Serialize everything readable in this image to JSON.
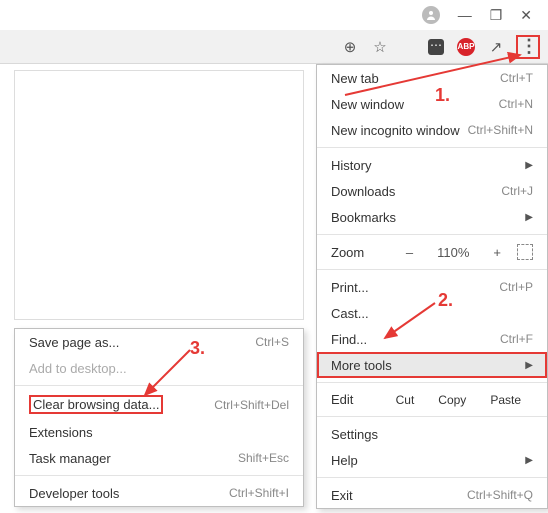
{
  "window": {
    "minimize": "—",
    "maximize": "❐",
    "close": "✕"
  },
  "toolbar": {
    "zoom_icon": "⊕",
    "star_icon": "☆",
    "share_icon": "↗"
  },
  "menu": {
    "new_tab": {
      "label": "New tab",
      "shortcut": "Ctrl+T"
    },
    "new_window": {
      "label": "New window",
      "shortcut": "Ctrl+N"
    },
    "new_incognito": {
      "label": "New incognito window",
      "shortcut": "Ctrl+Shift+N"
    },
    "history": {
      "label": "History"
    },
    "downloads": {
      "label": "Downloads",
      "shortcut": "Ctrl+J"
    },
    "bookmarks": {
      "label": "Bookmarks"
    },
    "zoom": {
      "label": "Zoom",
      "minus": "–",
      "value": "110%",
      "plus": "+"
    },
    "print": {
      "label": "Print...",
      "shortcut": "Ctrl+P"
    },
    "cast": {
      "label": "Cast..."
    },
    "find": {
      "label": "Find...",
      "shortcut": "Ctrl+F"
    },
    "more_tools": {
      "label": "More tools"
    },
    "edit": {
      "label": "Edit",
      "cut": "Cut",
      "copy": "Copy",
      "paste": "Paste"
    },
    "settings": {
      "label": "Settings"
    },
    "help": {
      "label": "Help"
    },
    "exit": {
      "label": "Exit",
      "shortcut": "Ctrl+Shift+Q"
    }
  },
  "submenu": {
    "save_page": {
      "label": "Save page as...",
      "shortcut": "Ctrl+S"
    },
    "add_desktop": {
      "label": "Add to desktop..."
    },
    "clear_data": {
      "label": "Clear browsing data...",
      "shortcut": "Ctrl+Shift+Del"
    },
    "extensions": {
      "label": "Extensions"
    },
    "task_manager": {
      "label": "Task manager",
      "shortcut": "Shift+Esc"
    },
    "dev_tools": {
      "label": "Developer tools",
      "shortcut": "Ctrl+Shift+I"
    }
  },
  "annotations": {
    "step1": "1.",
    "step2": "2.",
    "step3": "3."
  }
}
